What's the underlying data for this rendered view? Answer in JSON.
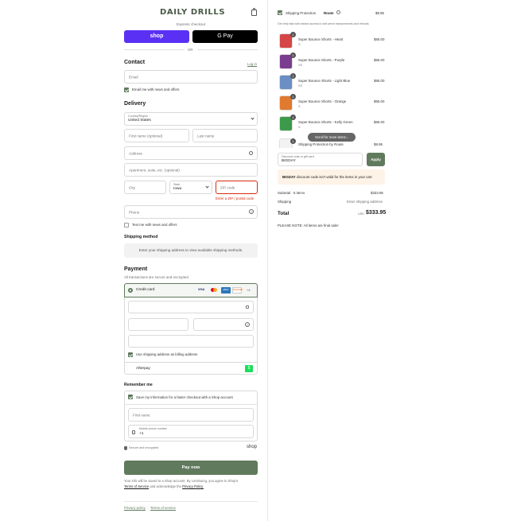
{
  "brand": "DAILY DRILLS",
  "express_checkout": "Express checkout",
  "shop_pay_label": "shop",
  "gpay_label": "G Pay",
  "or": "OR",
  "contact": {
    "title": "Contact",
    "login": "Log in",
    "email_placeholder": "Email",
    "news_label": "Email me with news and offers"
  },
  "delivery": {
    "title": "Delivery",
    "country_label": "Country/Region",
    "country_value": "United States",
    "first_name": "First name (optional)",
    "last_name": "Last name",
    "address": "Address",
    "apartment": "Apartment, suite, etc. (optional)",
    "city": "City",
    "state_label": "State",
    "state_value": "Iowa",
    "zip": "ZIP code",
    "zip_error": "Enter a ZIP / postal code",
    "phone": "Phone",
    "text_news": "Text me with news and offers"
  },
  "shipping_method": {
    "title": "Shipping method",
    "notice": "Enter your shipping address to view available shipping methods."
  },
  "payment": {
    "title": "Payment",
    "subtitle": "All transactions are secure and encrypted.",
    "credit_card": "Credit card",
    "card_logos": [
      "VISA",
      "MC",
      "AMEX",
      "DISCOVER"
    ],
    "more_cards": "+4",
    "billing_same": "Use shipping address as billing address",
    "afterpay": "Afterpay"
  },
  "remember": {
    "title": "Remember me",
    "save_info": "Save my information for a faster checkout with a Shop account",
    "first_name": "First name",
    "mobile_label": "Mobile phone number",
    "mobile_value": "+1",
    "secure": "Secure and encrypted",
    "shop": "shop"
  },
  "pay_now": "Pay now",
  "terms": {
    "text1": "Your info will be saved to a Shop account. By continuing, you agree to Shop's",
    "tos": "Terms of Service",
    "and": "and acknowledge the",
    "privacy": "Privacy Policy."
  },
  "footer": {
    "privacy": "Privacy policy",
    "terms": "Terms of service"
  },
  "summary": {
    "protection_label": "Shipping Protection",
    "route": "Route",
    "protection_price": "$8.95",
    "protection_desc": "Get help fast with instant access to self-serve replacements and refunds",
    "items": [
      {
        "name": "Super Bounce Shorts - Heart",
        "variant": "S",
        "price": "$65.00",
        "qty": "1",
        "color": "#d64545"
      },
      {
        "name": "Super Bounce Shorts - Purple",
        "variant": "XS",
        "price": "$65.00",
        "qty": "1",
        "color": "#7a3d8f"
      },
      {
        "name": "Super Bounce Shorts - Light Blue",
        "variant": "XS",
        "price": "$65.00",
        "qty": "1",
        "color": "#6b8fc4"
      },
      {
        "name": "Super Bounce Shorts - Orange",
        "variant": "S",
        "price": "$65.00",
        "qty": "1",
        "color": "#e07a2e"
      },
      {
        "name": "Super Bounce Shorts - Kelly Green",
        "variant": "S",
        "price": "$65.00",
        "qty": "1",
        "color": "#3c9a4a"
      },
      {
        "name": "Shipping Protection by Route",
        "variant": "",
        "price": "$8.95",
        "qty": "1",
        "color": "#f2f2f2"
      }
    ],
    "scroll_hint": "Scroll for more items",
    "discount_label": "Discount code or gift card",
    "discount_value": "BIGDAY",
    "apply": "Apply",
    "discount_error_code": "BIGDAY",
    "discount_error_text": "discount code isn't valid for the items in your cart",
    "subtotal_label": "Subtotal · 6 items",
    "subtotal_value": "$333.95",
    "shipping_label": "Shipping",
    "shipping_value": "Enter shipping address",
    "total_label": "Total",
    "currency": "USD",
    "total_value": "$333.95",
    "note": "PLEASE NOTE: All items are final sale!"
  },
  "colors": {
    "accent": "#5f7a5c",
    "shop_purple": "#5a31f4",
    "error": "#d82c0d"
  }
}
